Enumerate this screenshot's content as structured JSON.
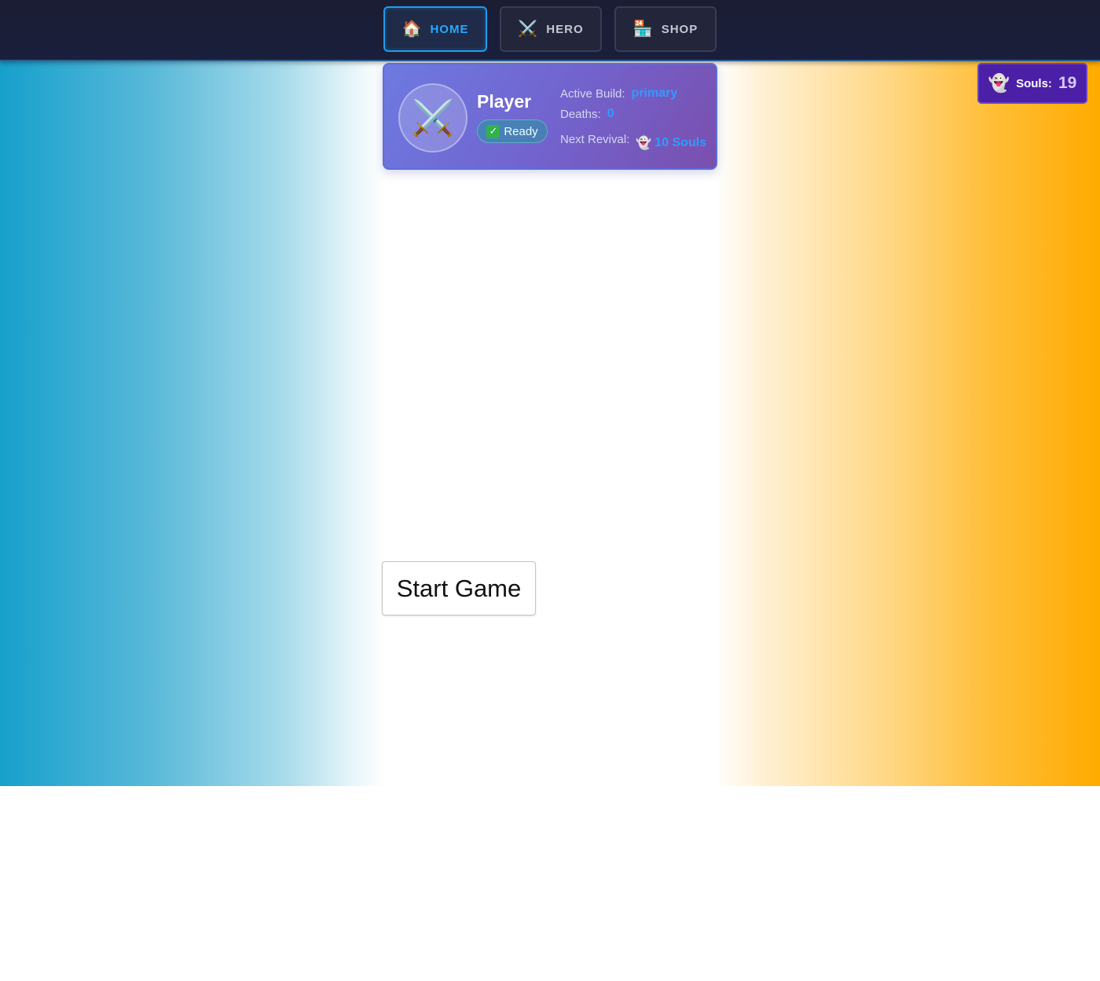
{
  "nav": {
    "tabs": [
      {
        "label": "HOME",
        "icon": "🏠",
        "icon_name": "house-icon",
        "active": true
      },
      {
        "label": "HERO",
        "icon": "⚔️",
        "icon_name": "crossed-swords-icon",
        "active": false
      },
      {
        "label": "SHOP",
        "icon": "🏪",
        "icon_name": "shop-icon",
        "active": false
      }
    ],
    "active_color": "#2aa7ff"
  },
  "player": {
    "avatar_icon": "⚔️",
    "name": "Player",
    "status_icon": "✓",
    "status": "Ready",
    "active_build_label": "Active Build:",
    "active_build": "primary",
    "deaths_label": "Deaths:",
    "deaths": "0",
    "next_revival_label": "Next Revival:",
    "next_revival_icon": "👻",
    "next_revival": "10 Souls"
  },
  "souls": {
    "icon": "👻",
    "label": "Souls:",
    "value": "19"
  },
  "actions": {
    "start_label": "Start Game"
  },
  "colors": {
    "left_gradient": "#16a0cc",
    "right_gradient": "#ffab00",
    "card": "#7264cf",
    "souls_box": "#4b1fa6",
    "accent": "#2e9cff"
  }
}
